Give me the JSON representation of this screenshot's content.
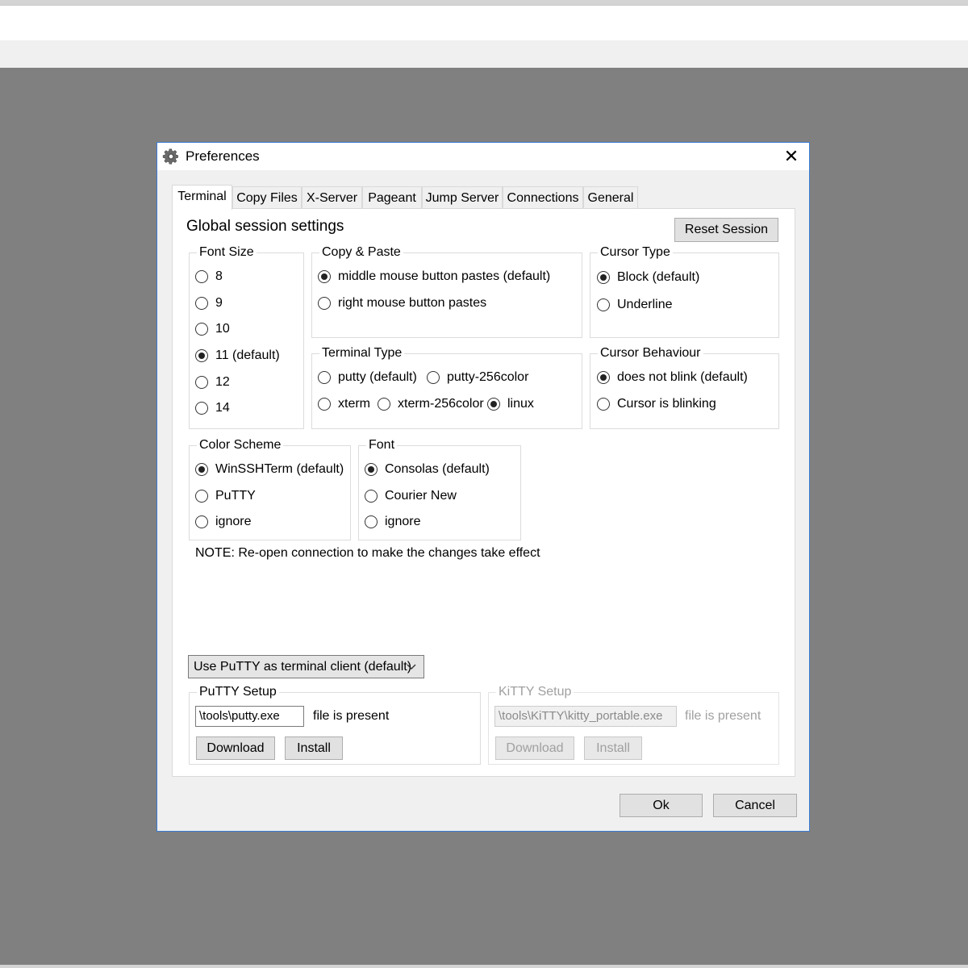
{
  "window": {
    "title": "Preferences",
    "close_glyph": "✕",
    "icon": "gear-icon"
  },
  "tabs": [
    {
      "label": "Terminal",
      "active": true
    },
    {
      "label": "Copy Files",
      "active": false
    },
    {
      "label": "X-Server",
      "active": false
    },
    {
      "label": "Pageant",
      "active": false
    },
    {
      "label": "Jump Server",
      "active": false
    },
    {
      "label": "Connections",
      "active": false
    },
    {
      "label": "General",
      "active": false
    }
  ],
  "panel": {
    "heading": "Global session settings",
    "reset_button": "Reset Session",
    "note": "NOTE: Re-open connection to make the changes take effect"
  },
  "font_size": {
    "legend": "Font Size",
    "options": [
      "8",
      "9",
      "10",
      "11 (default)",
      "12",
      "14"
    ],
    "selected": "11 (default)"
  },
  "copy_paste": {
    "legend": "Copy & Paste",
    "options": [
      "middle mouse button pastes (default)",
      "right mouse button pastes"
    ],
    "selected": "middle mouse button pastes (default)"
  },
  "cursor_type": {
    "legend": "Cursor Type",
    "options": [
      "Block (default)",
      "Underline"
    ],
    "selected": "Block (default)"
  },
  "terminal_type": {
    "legend": "Terminal Type",
    "options": [
      "putty (default)",
      "putty-256color",
      "xterm",
      "xterm-256color",
      "linux"
    ],
    "selected": "linux"
  },
  "cursor_behaviour": {
    "legend": "Cursor Behaviour",
    "options": [
      "does not blink (default)",
      "Cursor is blinking"
    ],
    "selected": "does not blink (default)"
  },
  "color_scheme": {
    "legend": "Color Scheme",
    "options": [
      "WinSSHTerm (default)",
      "PuTTY",
      "ignore"
    ],
    "selected": "WinSSHTerm (default)"
  },
  "font": {
    "legend": "Font",
    "options": [
      "Consolas (default)",
      "Courier New",
      "ignore"
    ],
    "selected": "Consolas (default)"
  },
  "terminal_client": {
    "selected": "Use PuTTY as terminal client (default)"
  },
  "putty_setup": {
    "legend": "PuTTY Setup",
    "path": "\\tools\\putty.exe",
    "status": "file is present",
    "download": "Download",
    "install": "Install"
  },
  "kitty_setup": {
    "legend": "KiTTY Setup",
    "path": "\\tools\\KiTTY\\kitty_portable.exe",
    "status": "file is present",
    "download": "Download",
    "install": "Install"
  },
  "footer": {
    "ok": "Ok",
    "cancel": "Cancel"
  }
}
